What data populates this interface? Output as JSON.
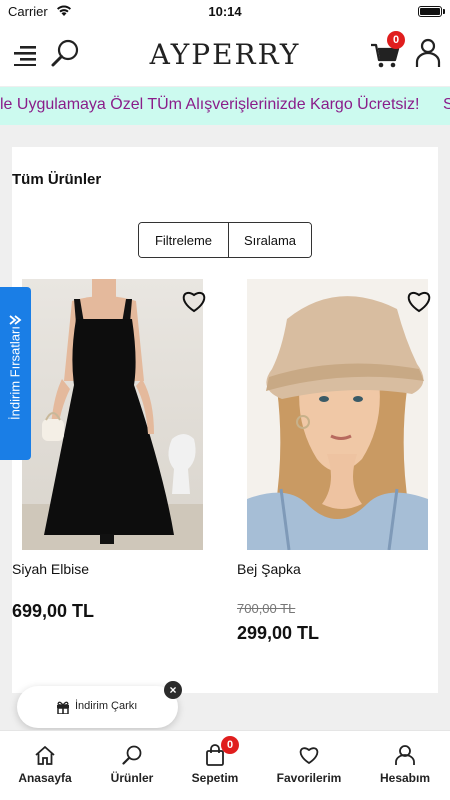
{
  "status_bar": {
    "carrier": "Carrier",
    "time": "10:14"
  },
  "header": {
    "logo": "AYPERRY",
    "cart_count": "0"
  },
  "marquee": {
    "text": "le Uygulamaya Özel TÜm Alışverişlerinizde Kargo Ücretsiz!",
    "next_text": "S"
  },
  "content": {
    "title": "Tüm Ürünler",
    "filter_label": "Filtreleme",
    "sort_label": "Sıralama"
  },
  "products": [
    {
      "name": "Siyah Elbise",
      "price": "699,00 TL"
    },
    {
      "name": "Bej Şapka",
      "old_price": "700,00 TL",
      "price": "299,00 TL"
    }
  ],
  "side_tab": {
    "label": "İndirim Fırsatları"
  },
  "wheel": {
    "label": "İndirim Çarkı"
  },
  "bottom_nav": {
    "items": [
      {
        "label": "Anasayfa",
        "icon": "home-icon"
      },
      {
        "label": "Ürünler",
        "icon": "search-icon"
      },
      {
        "label": "Sepetim",
        "icon": "bag-icon",
        "badge": "0"
      },
      {
        "label": "Favorilerim",
        "icon": "heart-icon"
      },
      {
        "label": "Hesabım",
        "icon": "user-icon"
      }
    ]
  },
  "colors": {
    "marquee_bg": "#ccfaef",
    "marquee_text": "#8a1d8a",
    "side_tab": "#1a7ee6",
    "badge": "#e01e1e"
  }
}
